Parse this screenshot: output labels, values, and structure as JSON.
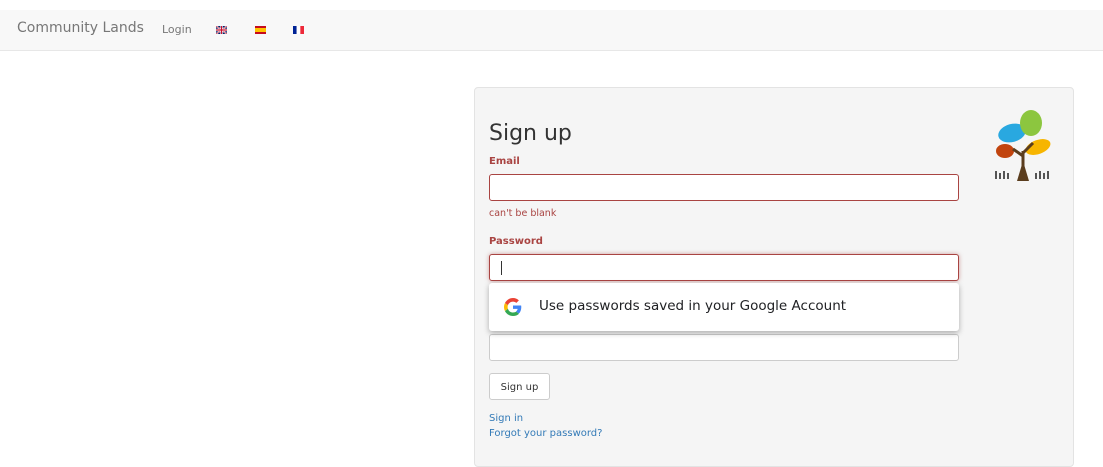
{
  "nav": {
    "brand": "Community Lands",
    "login": "Login",
    "flags": [
      "uk-flag-icon",
      "spain-flag-icon",
      "france-flag-icon"
    ]
  },
  "form": {
    "title": "Sign up",
    "email_label": "Email",
    "email_value": "",
    "email_error": "can't be blank",
    "password_label": "Password",
    "password_value": "",
    "confirmation_value": "",
    "submit_label": "Sign up"
  },
  "links": {
    "sign_in": "Sign in",
    "forgot_password": "Forgot your password?"
  },
  "autofill": {
    "text": "Use passwords saved in your Google Account"
  },
  "colors": {
    "error": "#a94442",
    "link": "#337ab7",
    "navbar_bg": "#f8f8f8",
    "panel_bg": "#f5f5f5"
  }
}
